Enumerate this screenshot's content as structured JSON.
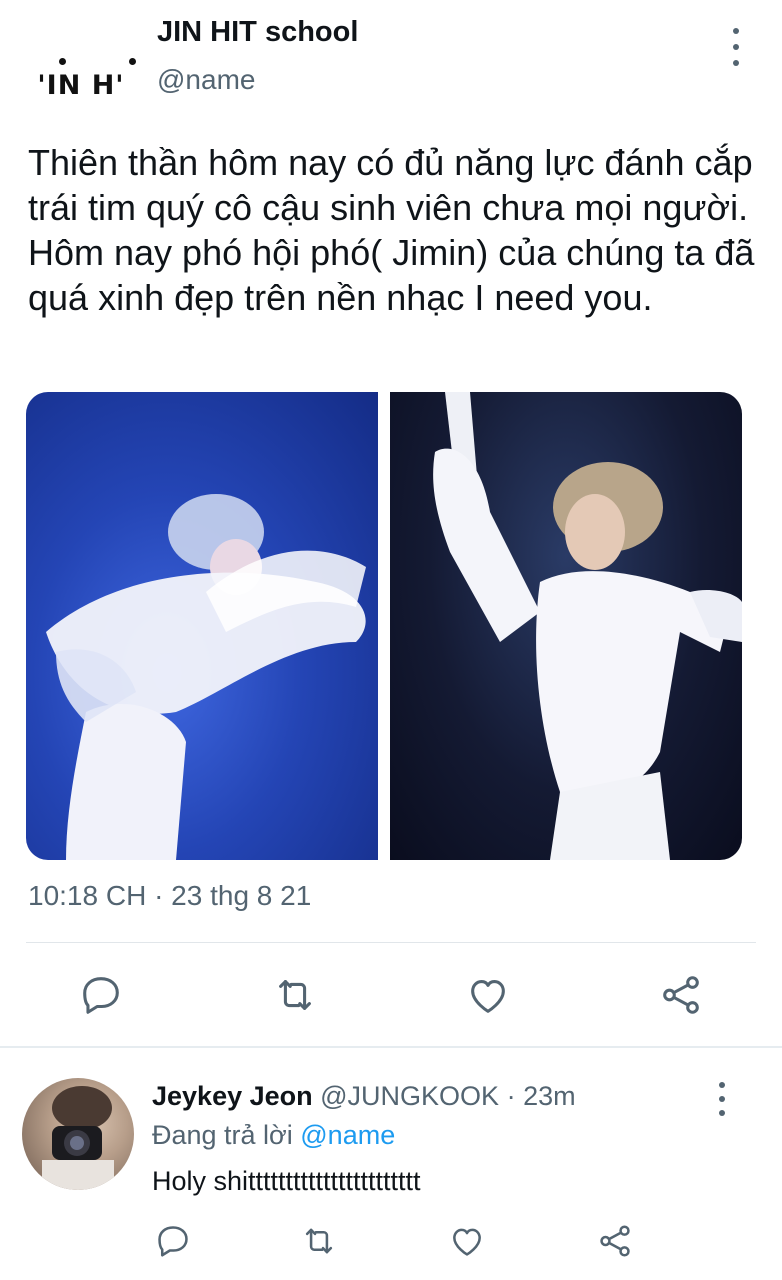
{
  "tweet": {
    "display_name": "JIN HIT school",
    "handle": "@name",
    "logo_text": "'IN H'",
    "text": "Thiên thần hôm nay có đủ năng lực đánh cắp trái tim quý cô cậu sinh viên chưa mọi người. Hôm nay phó hội phó( Jimin) của chúng ta đã quá xinh đẹp trên nền nhạc I need you.",
    "timestamp": "10:18 CH · 23 thg 8 21",
    "actions": [
      "reply-icon",
      "retweet-icon",
      "like-icon",
      "share-icon"
    ]
  },
  "reply": {
    "display_name": "Jeykey Jeon",
    "handle": "@JUNGKOOK",
    "separator": " · ",
    "time": "23m",
    "replying_prefix": "Đang trả lời ",
    "replying_to": "@name",
    "text": "Holy shittttttttttttttttttttttt",
    "actions": [
      "reply-icon",
      "retweet-icon",
      "like-icon",
      "share-icon"
    ]
  },
  "colors": {
    "text_primary": "#0f1419",
    "text_secondary": "#536471",
    "link": "#1d9bf0",
    "icon": "#536471",
    "divider": "#e1e6ea"
  }
}
